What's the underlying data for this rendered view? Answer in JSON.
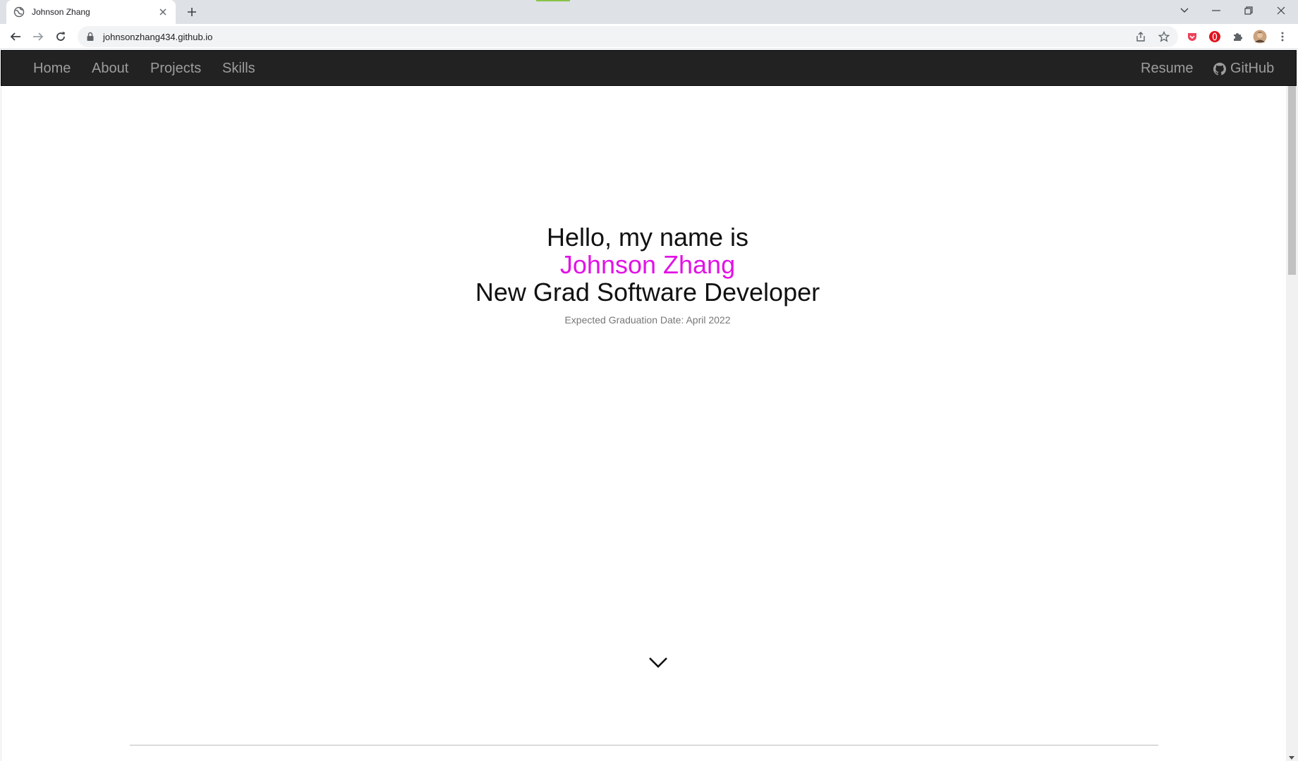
{
  "browser": {
    "tab_title": "Johnson Zhang",
    "url": "johnsonzhang434.github.io"
  },
  "icons": {
    "favicon": "globe-icon",
    "tab_close": "close-icon",
    "new_tab": "plus-icon",
    "back": "arrow-left-icon",
    "forward": "arrow-right-icon",
    "reload": "reload-icon",
    "lock": "lock-icon",
    "share": "share-icon",
    "bookmark": "star-icon",
    "extension_red": "pocket-icon",
    "extension_opera": "opera-icon",
    "extensions": "puzzle-icon",
    "profile": "avatar-icon",
    "menu": "kebab-menu-icon",
    "scroll_down": "chevron-down-icon"
  },
  "navbar": {
    "left": [
      "Home",
      "About",
      "Projects",
      "Skills"
    ],
    "right_resume": "Resume",
    "right_github": "GitHub"
  },
  "hero": {
    "greeting": "Hello, my name is",
    "name": "Johnson Zhang",
    "role": "New Grad Software Developer",
    "graduation": "Expected Graduation Date: April 2022"
  },
  "colors": {
    "navbar_bg": "#222222",
    "nav_text": "#9d9d9d",
    "name_accent": "#e212e6"
  }
}
